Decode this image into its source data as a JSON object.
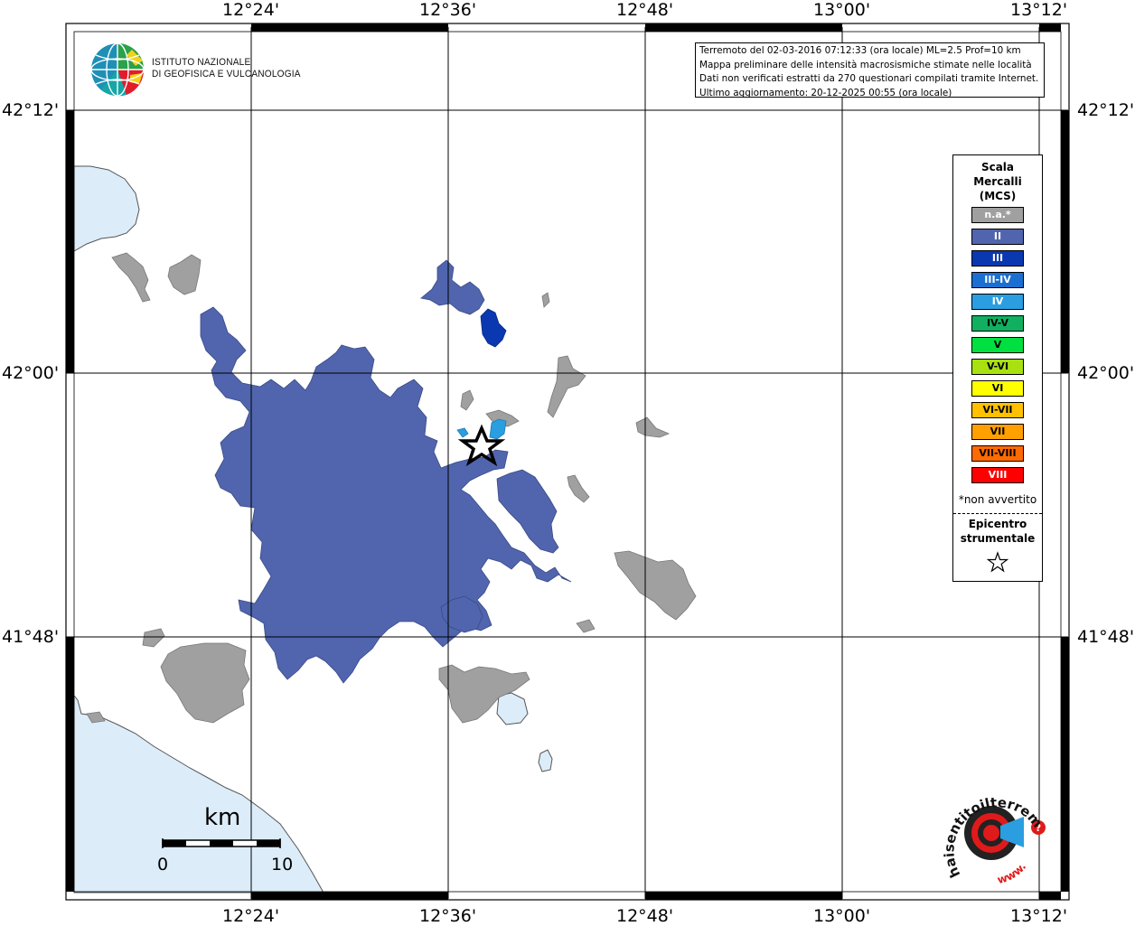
{
  "map": {
    "frame_ticks": {
      "top": [
        "12°24'",
        "12°36'",
        "12°48'",
        "13°00'",
        "13°12'"
      ],
      "bottom": [
        "12°24'",
        "12°36'",
        "12°48'",
        "13°00'",
        "13°12'"
      ],
      "left": [
        "42°12'",
        "42°00'",
        "41°48'"
      ],
      "right": [
        "42°12'",
        "42°00'",
        "41°48'"
      ]
    },
    "colors": {
      "sea": "#dcedf9",
      "not_felt": "#a0a0a0",
      "II": "#5065ad",
      "III": "#0a38b0",
      "IV": "#2a9ee0",
      "epicenter": "#000000"
    }
  },
  "logo": {
    "line1": "ISTITUTO NAZIONALE",
    "line2": "DI GEOFISICA E VULCANOLOGIA"
  },
  "info": {
    "line1": "Terremoto del 02-03-2016 07:12:33 (ora locale) ML=2.5 Prof=10 km",
    "line2": "Mappa preliminare delle intensità macrosismiche stimate nelle località",
    "line3": "Dati non verificati estratti da 270 questionari compilati tramite Internet.",
    "line4": "Ultimo aggiornamento: 20-12-2025 00:55 (ora locale)"
  },
  "legend": {
    "title1": "Scala",
    "title2": "Mercalli",
    "title3": "(MCS)",
    "items": [
      {
        "label": "n.a.*",
        "color": "#a0a0a0",
        "text": "#ffffff"
      },
      {
        "label": "II",
        "color": "#5065ad",
        "text": "#ffffff"
      },
      {
        "label": "III",
        "color": "#0a38b0",
        "text": "#ffffff"
      },
      {
        "label": "III-IV",
        "color": "#1a6fd0",
        "text": "#ffffff"
      },
      {
        "label": "IV",
        "color": "#2a9ee0",
        "text": "#ffffff"
      },
      {
        "label": "IV-V",
        "color": "#10b060",
        "text": "#000000"
      },
      {
        "label": "V",
        "color": "#00e040",
        "text": "#000000"
      },
      {
        "label": "V-VI",
        "color": "#a8e010",
        "text": "#000000"
      },
      {
        "label": "VI",
        "color": "#ffff00",
        "text": "#000000"
      },
      {
        "label": "VI-VII",
        "color": "#ffc000",
        "text": "#000000"
      },
      {
        "label": "VII",
        "color": "#ffa000",
        "text": "#000000"
      },
      {
        "label": "VII-VIII",
        "color": "#ff6a00",
        "text": "#000000"
      },
      {
        "label": "VIII",
        "color": "#ff0000",
        "text": "#ffffff"
      }
    ],
    "note": "*non avvertito",
    "epicenter1": "Epicentro",
    "epicenter2": "strumentale"
  },
  "scalebar": {
    "unit": "km",
    "start": "0",
    "end": "10"
  },
  "badge": {
    "arc_text": "haisentitoilterremoto.it",
    "www": "www.",
    "question": "?"
  }
}
